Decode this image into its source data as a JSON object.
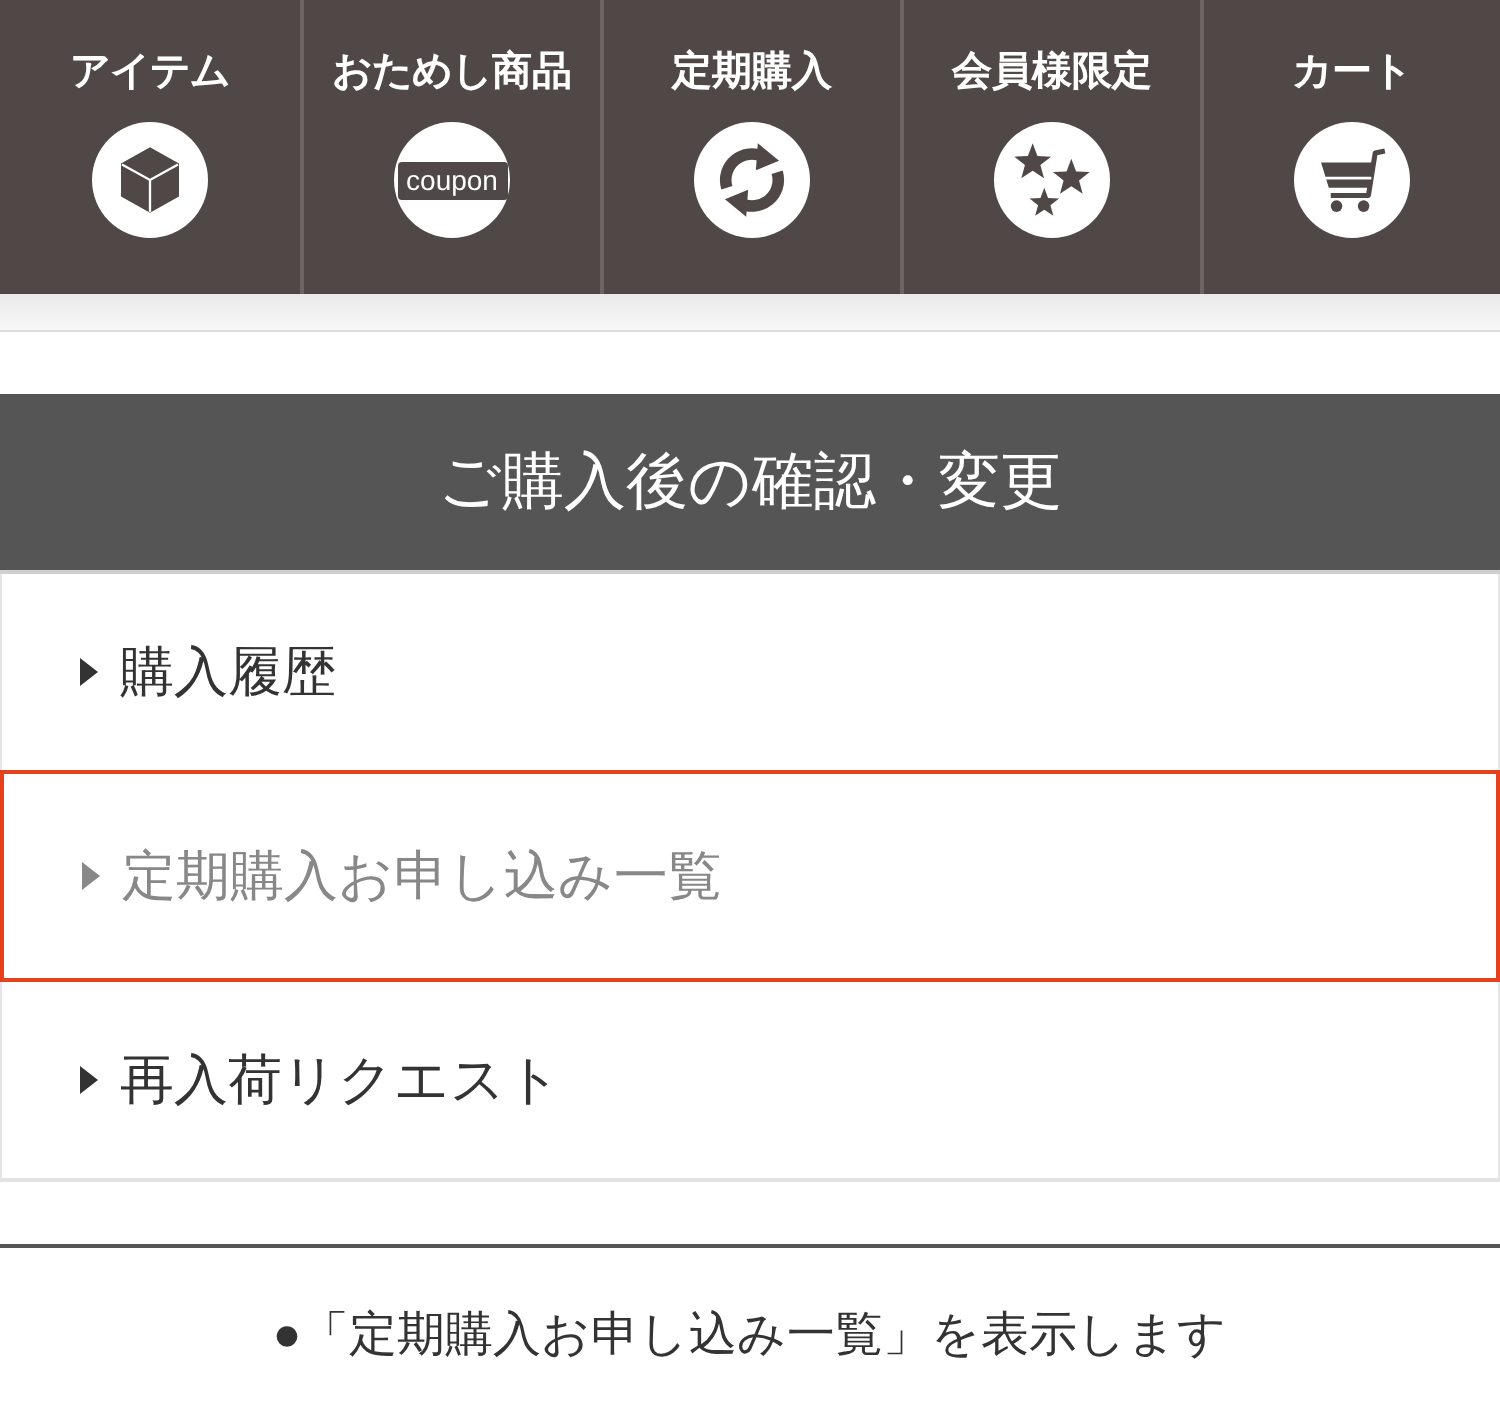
{
  "nav": {
    "items": [
      {
        "label": "アイテム",
        "kind": "box"
      },
      {
        "label": "おためし商品",
        "kind": "coupon",
        "icon_text": "coupon"
      },
      {
        "label": "定期購入",
        "kind": "refresh"
      },
      {
        "label": "会員様限定",
        "kind": "stars"
      },
      {
        "label": "カート",
        "kind": "cart"
      }
    ]
  },
  "section": {
    "title": "ご購入後の確認・変更",
    "items": [
      {
        "label": "購入履歴",
        "selected": false
      },
      {
        "label": "定期購入お申し込み一覧",
        "selected": true
      },
      {
        "label": "再入荷リクエスト",
        "selected": false
      }
    ]
  },
  "caption": {
    "text": "●「定期購入お申し込み一覧」を表示します"
  }
}
